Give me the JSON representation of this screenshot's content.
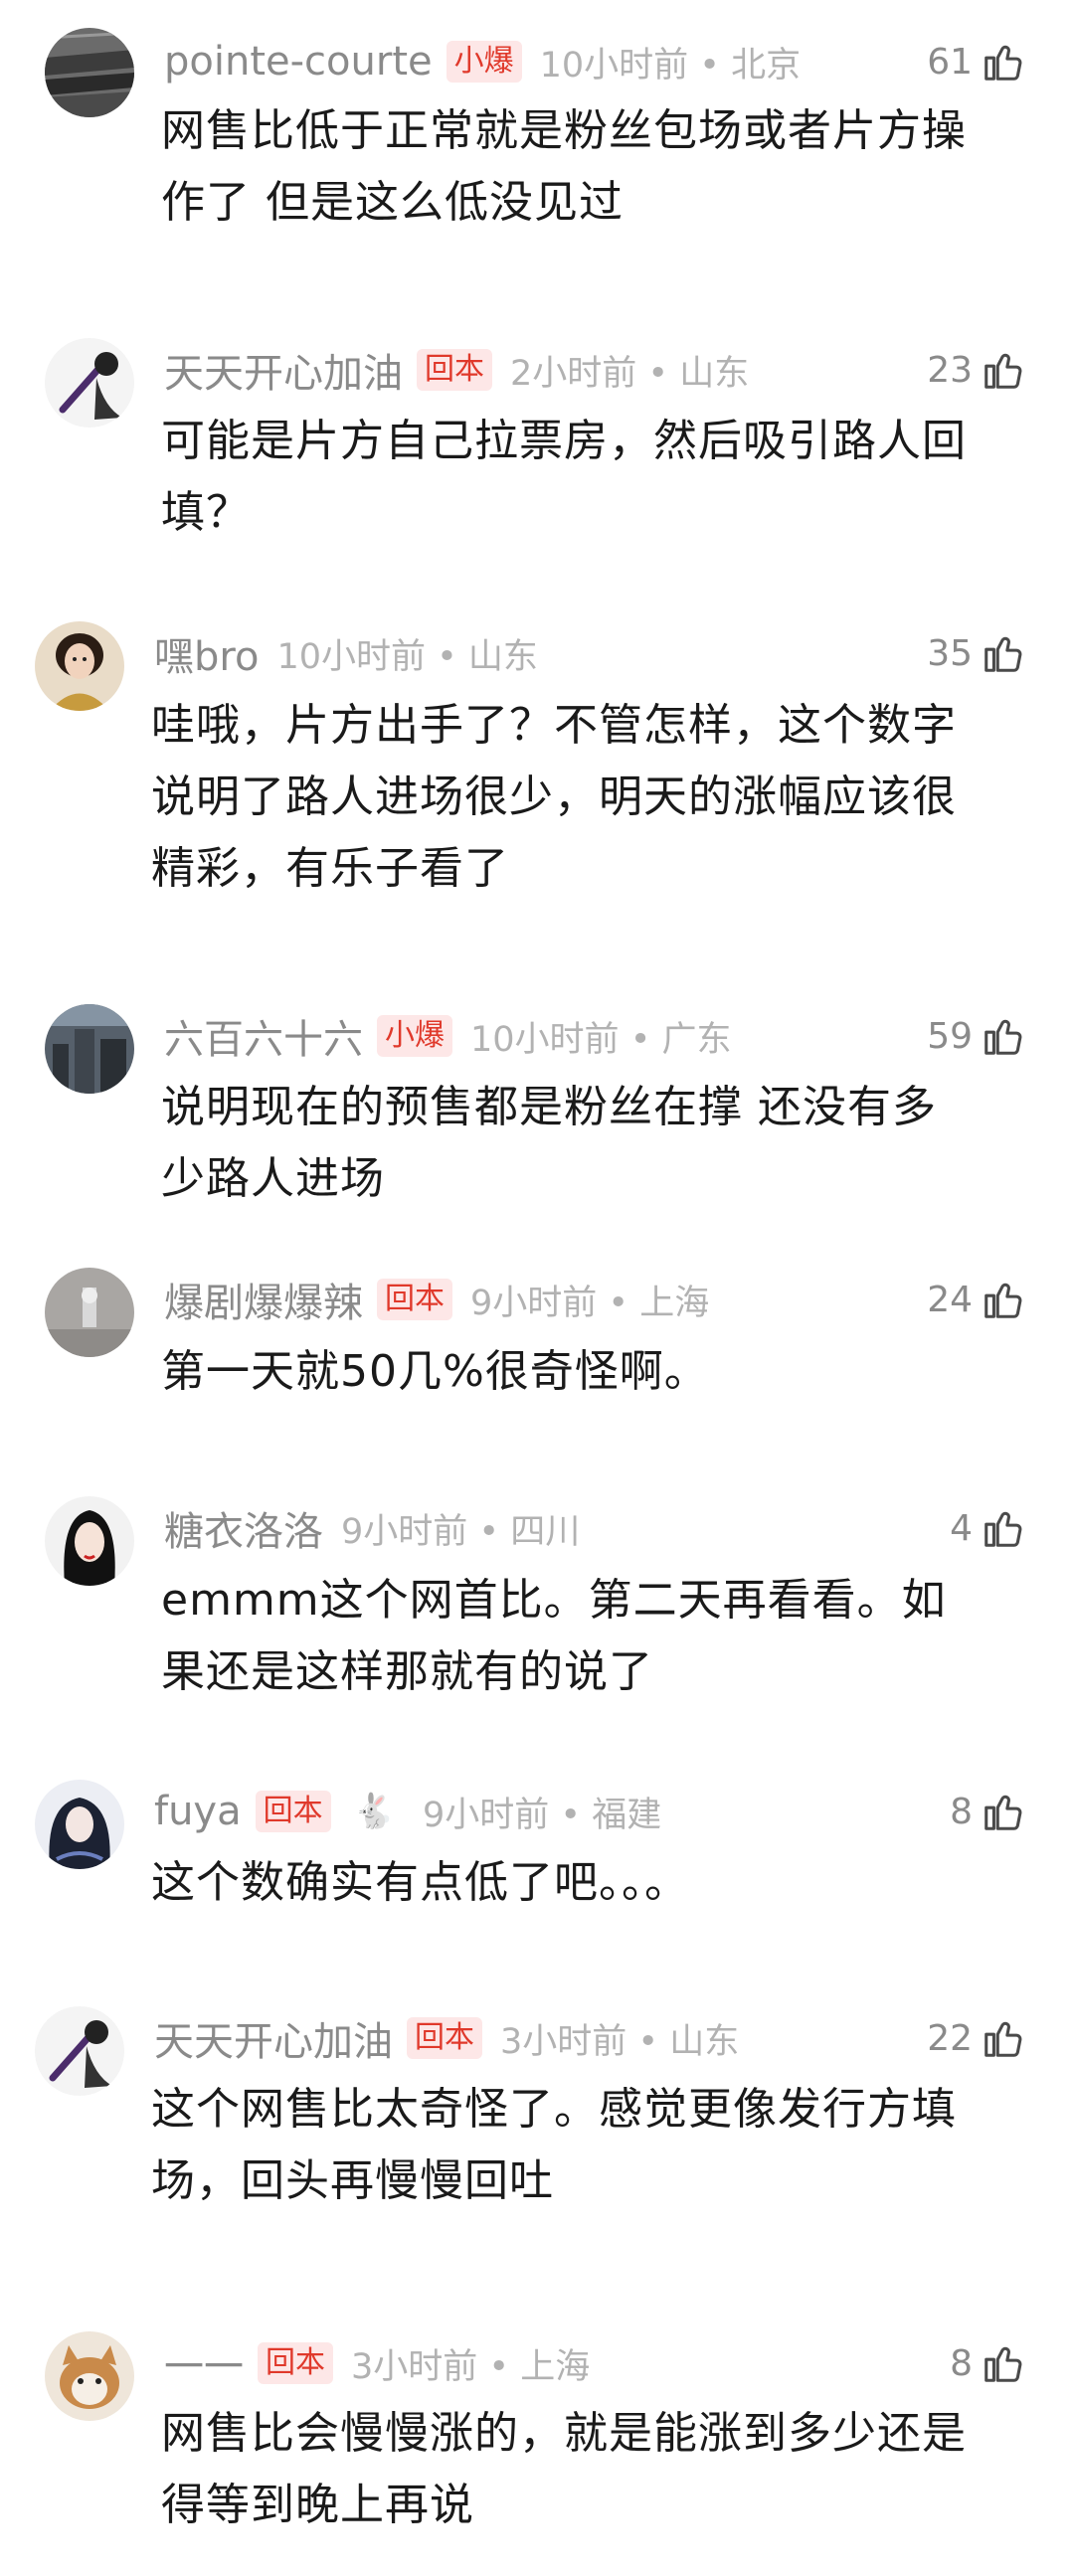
{
  "comments": [
    {
      "username": "pointe-courte",
      "badge": "小爆",
      "time": "10小时前",
      "location": "北京",
      "likes": "61",
      "text": [
        "网售比低于正常就是粉丝包场或者片方操",
        "作了 但是这么低没见过"
      ]
    },
    {
      "username": "天天开心加油",
      "badge": "回本",
      "time": "2小时前",
      "location": "山东",
      "likes": "23",
      "text": [
        "可能是片方自己拉票房，然后吸引路人回",
        "填？"
      ]
    },
    {
      "username": "嘿bro",
      "badge": "",
      "time": "10小时前",
      "location": "山东",
      "likes": "35",
      "text": [
        "哇哦，片方出手了？不管怎样，这个数字",
        "说明了路人进场很少，明天的涨幅应该很",
        "精彩，有乐子看了"
      ]
    },
    {
      "username": "六百六十六",
      "badge": "小爆",
      "time": "10小时前",
      "location": "广东",
      "likes": "59",
      "text": [
        "说明现在的预售都是粉丝在撑 还没有多",
        "少路人进场"
      ]
    },
    {
      "username": "爆剧爆爆辣",
      "badge": "回本",
      "time": "9小时前",
      "location": "上海",
      "likes": "24",
      "text": [
        "第一天就50几%很奇怪啊。"
      ]
    },
    {
      "username": "糖衣洛洛",
      "badge": "",
      "time": "9小时前",
      "location": "四川",
      "likes": "4",
      "text": [
        "emmm这个网首比。第二天再看看。如",
        "果还是这样那就有的说了"
      ]
    },
    {
      "username": "fuya",
      "badge": "回本",
      "emoji": "🐇",
      "time": "9小时前",
      "location": "福建",
      "likes": "8",
      "text": [
        "这个数确实有点低了吧。。。"
      ]
    },
    {
      "username": "天天开心加油",
      "badge": "回本",
      "time": "3小时前",
      "location": "山东",
      "likes": "22",
      "text": [
        "这个网售比太奇怪了。感觉更像发行方填",
        "场，回头再慢慢回吐"
      ]
    },
    {
      "username": "一一",
      "badge": "回本",
      "time": "3小时前",
      "location": "上海",
      "likes": "8",
      "text": [
        "网售比会慢慢涨的，就是能涨到多少还是",
        "得等到晚上再说"
      ]
    }
  ],
  "separator": "•",
  "colors": {
    "username": "#8a8a8a",
    "meta": "#b2b2b2",
    "badge_text": "#e0392b",
    "badge_bg": "#fde7e7",
    "body_text": "#1a1a1a"
  },
  "icons": {
    "like": "thumbs-up-icon",
    "avatar": "avatar-image"
  }
}
